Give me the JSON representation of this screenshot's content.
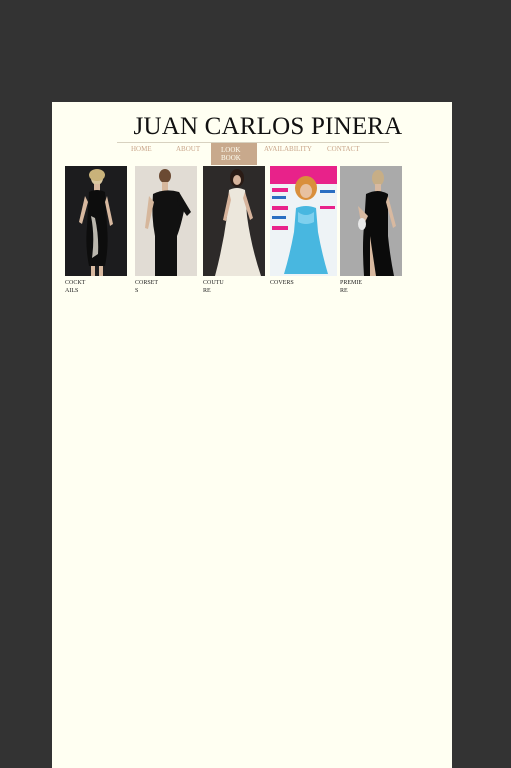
{
  "site": {
    "title": "JUAN CARLOS PINERA"
  },
  "nav": {
    "items": [
      {
        "label": "HOME"
      },
      {
        "label": "ABOUT"
      },
      {
        "label": "LOOK BOOK",
        "active": true
      },
      {
        "label": "AVAILABILITY"
      },
      {
        "label": "CONTACT"
      }
    ]
  },
  "gallery": {
    "items": [
      {
        "caption": "COCKTAILS"
      },
      {
        "caption": "CORSETS"
      },
      {
        "caption": "COUTURE"
      },
      {
        "caption": "COVERS"
      },
      {
        "caption": "PREMIERE"
      }
    ]
  },
  "colors": {
    "frame": "#333333",
    "page": "#fffff2",
    "nav_text": "#c9a58a",
    "nav_active_bg": "#c8a98c"
  }
}
